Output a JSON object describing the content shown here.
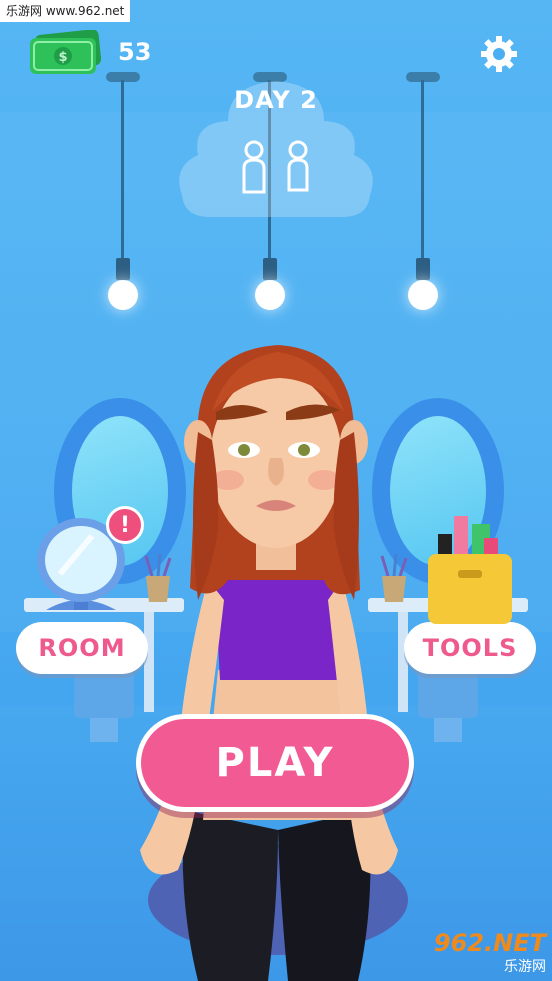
{
  "watermark_top": "乐游网 www.962.net",
  "currency": {
    "count": "53",
    "icon": "cash-icon",
    "color": "#2ec15a"
  },
  "settings": {
    "icon": "gear-icon"
  },
  "day": {
    "label": "DAY 2",
    "customers_total": 2
  },
  "room_button": {
    "label": "ROOM",
    "icon": "mirror-icon",
    "alert": "!"
  },
  "tools_button": {
    "label": "TOOLS",
    "icon": "makeup-box-icon"
  },
  "play_button": {
    "label": "PLAY",
    "color": "#f25a94"
  },
  "watermark_bottom": {
    "brand": "962.NET",
    "sub": "乐游网"
  },
  "colors": {
    "sky": "#4aaef2",
    "accent": "#ee5a8d",
    "alert": "#ee4f7d"
  }
}
